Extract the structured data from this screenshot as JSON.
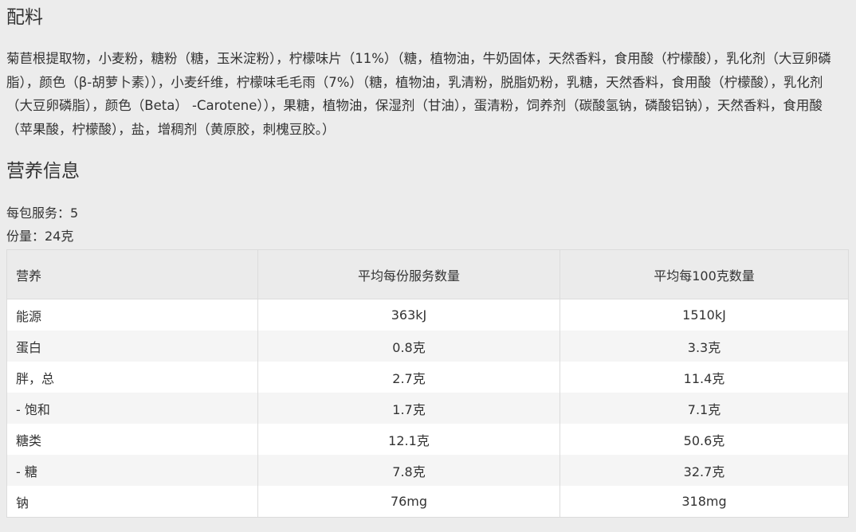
{
  "ingredients": {
    "title": "配料",
    "text": "菊苣根提取物，小麦粉，糖粉（糖，玉米淀粉），柠檬味片（11%）（糖，植物油，牛奶固体，天然香料，食用酸（柠檬酸），乳化剂（大豆卵磷脂），颜色（β-胡萝卜素）），小麦纤维，柠檬味毛毛雨（7%）（糖，植物油，乳清粉，脱脂奶粉，乳糖，天然香料，食用酸（柠檬酸），乳化剂（大豆卵磷脂），颜色（Beta） -Carotene）），果糖，植物油，保湿剂（甘油），蛋清粉，饲养剂（碳酸氢钠，磷酸铝钠），天然香料，食用酸（苹果酸，柠檬酸），盐，增稠剂（黄原胶，刺槐豆胶。）"
  },
  "nutrition": {
    "title": "营养信息",
    "servings_per_pack": "每包服务：5",
    "serving_size": "份量：24克",
    "columns": [
      "营养",
      "平均每份服务数量",
      "平均每100克数量"
    ],
    "rows": [
      {
        "name": "能源",
        "per_serving": "363kJ",
        "per_100g": "1510kJ"
      },
      {
        "name": "蛋白",
        "per_serving": "0.8克",
        "per_100g": "3.3克"
      },
      {
        "name": "胖，总",
        "per_serving": "2.7克",
        "per_100g": "11.4克"
      },
      {
        "name": "- 饱和",
        "per_serving": "1.7克",
        "per_100g": "7.1克"
      },
      {
        "name": "糖类",
        "per_serving": "12.1克",
        "per_100g": "50.6克"
      },
      {
        "name": "- 糖",
        "per_serving": "7.8克",
        "per_100g": "32.7克"
      },
      {
        "name": "钠",
        "per_serving": "76mg",
        "per_100g": "318mg"
      }
    ]
  }
}
